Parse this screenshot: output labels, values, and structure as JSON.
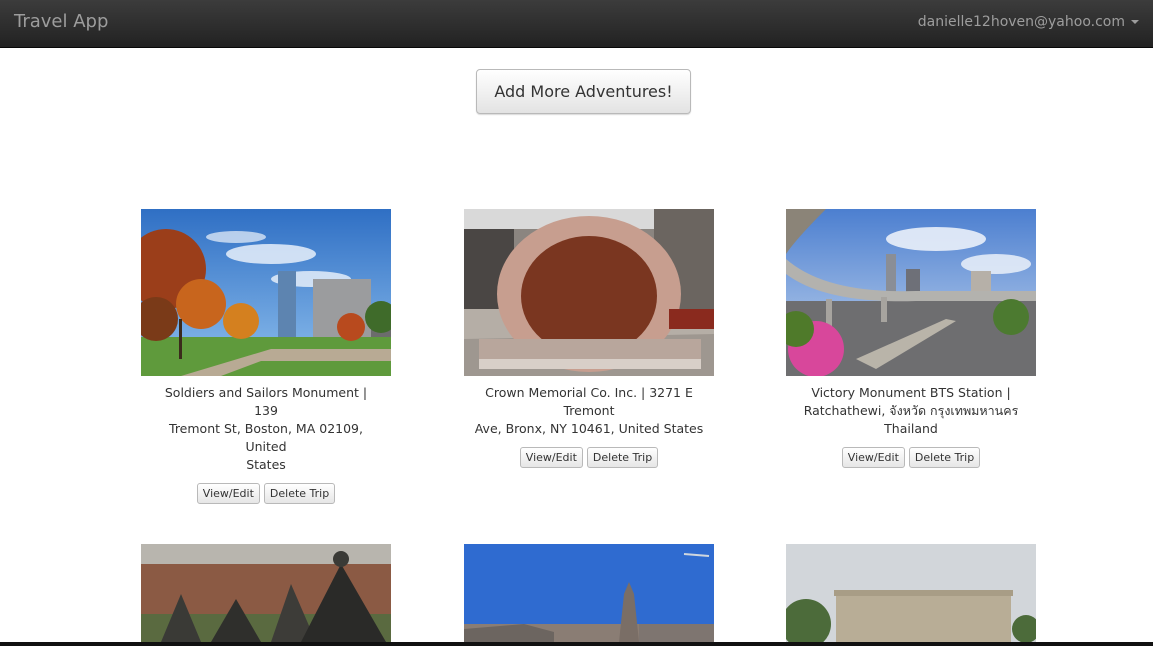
{
  "app": {
    "brand": "Travel App"
  },
  "user": {
    "email": "danielle12hoven@yahoo.com"
  },
  "actions": {
    "add_label": "Add More Adventures!"
  },
  "trips": [
    {
      "caption_line1": "Soldiers and Sailors Monument | 139",
      "caption_line2": "Tremont St, Boston, MA 02109, United",
      "caption_line3": "States",
      "view_label": "View/Edit",
      "delete_label": "Delete Trip"
    },
    {
      "caption_line1": "Crown Memorial Co. Inc. | 3271 E Tremont",
      "caption_line2": "Ave, Bronx, NY 10461, United States",
      "caption_line3": "",
      "view_label": "View/Edit",
      "delete_label": "Delete Trip"
    },
    {
      "caption_line1": "Victory Monument BTS Station |",
      "caption_line2": "Ratchathewi, จังหวัด กรุงเทพมหานคร",
      "caption_line3": "Thailand",
      "view_label": "View/Edit",
      "delete_label": "Delete Trip"
    }
  ]
}
